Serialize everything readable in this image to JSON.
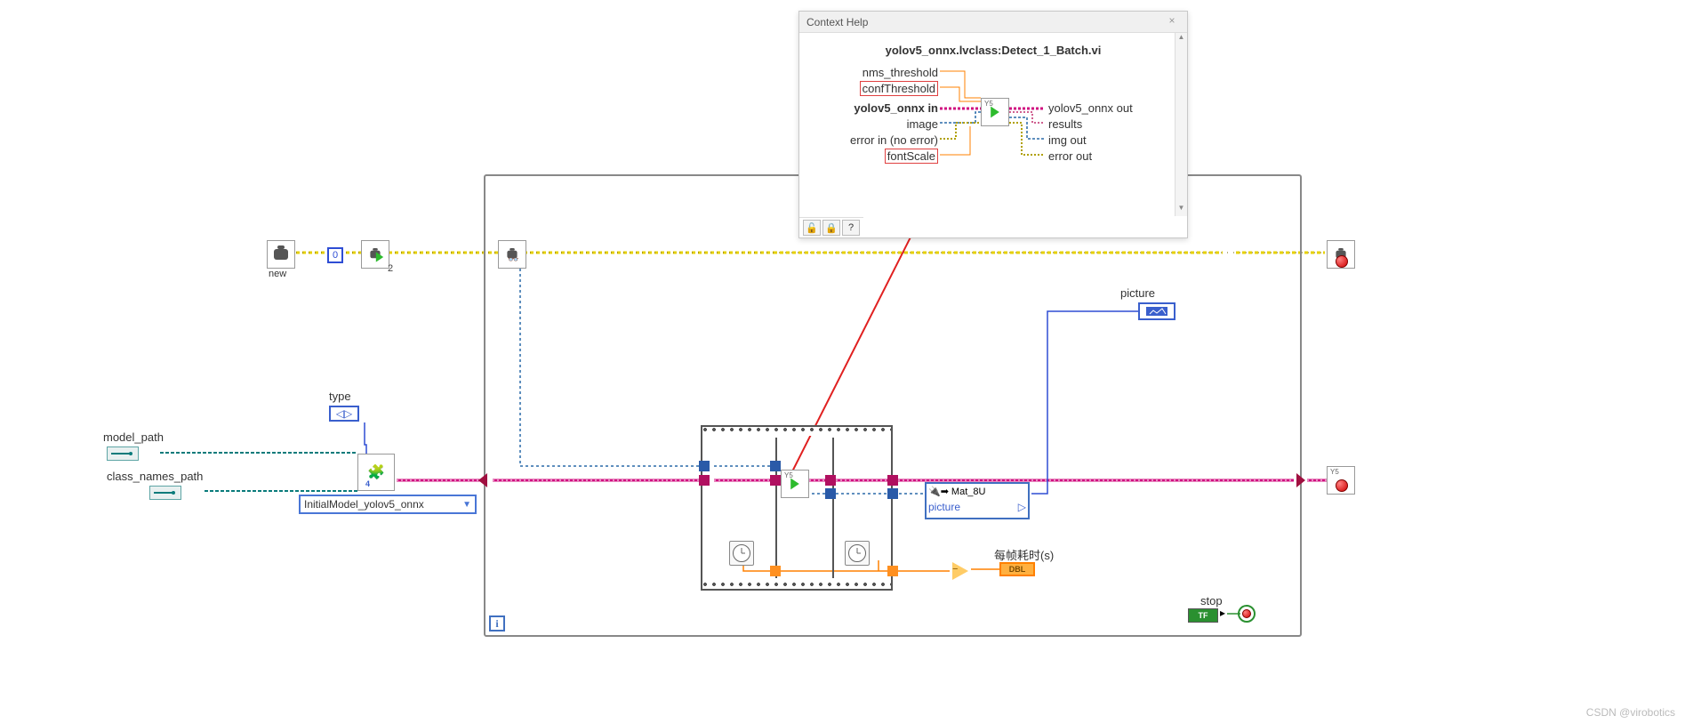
{
  "help_window": {
    "title": "Context Help",
    "vi_title": "yolov5_onnx.lvclass:Detect_1_Batch.vi",
    "inputs": {
      "nms_threshold": "nms_threshold",
      "confThreshold": "confThreshold",
      "class_in": "yolov5_onnx in",
      "image": "image",
      "error_in": "error in (no error)",
      "fontScale": "fontScale"
    },
    "outputs": {
      "class_out": "yolov5_onnx out",
      "results": "results",
      "img_out": "img out",
      "error_out": "error out"
    },
    "icon_tag": "Y5"
  },
  "labels": {
    "type": "type",
    "model_path": "model_path",
    "class_names_path": "class_names_path",
    "init_model_ring": "InitialModel_yolov5_onnx",
    "picture": "picture",
    "mat_xctl": "Mat_8U",
    "mat_xctl_sub": "picture",
    "frame_time": "每帧耗时(s)",
    "stop": "stop",
    "new_cam": "new",
    "int_zero": "0",
    "int_two": "2",
    "iter": "i",
    "tf": "TF",
    "dbl": "DBL"
  },
  "watermark": "CSDN @virobotics"
}
